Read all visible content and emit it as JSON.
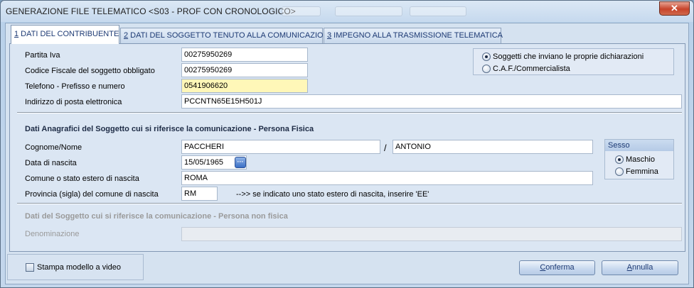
{
  "window": {
    "title": "GENERAZIONE FILE TELEMATICO <S03 - PROF CON CRONOLOGICO>",
    "close_glyph": "✕"
  },
  "tabs": [
    {
      "hotkey": "1",
      "label": " DATI DEL CONTRIBUENTE"
    },
    {
      "hotkey": "2",
      "label": " DATI DEL SOGGETTO TENUTO ALLA COMUNICAZIONE"
    },
    {
      "hotkey": "3",
      "label": " IMPEGNO ALLA TRASMISSIONE TELEMATICA"
    }
  ],
  "contribuente": {
    "partita_iva_label": "Partita Iva",
    "partita_iva_value": "00275950269",
    "codice_fiscale_label": "Codice Fiscale del soggetto obbligato",
    "codice_fiscale_value": "00275950269",
    "telefono_label": "Telefono - Prefisso e numero",
    "telefono_value": "0541906620",
    "email_label": "Indirizzo di posta elettronica",
    "email_value": "PCCNTN65E15H501J"
  },
  "tipo_soggetto": {
    "option1": "Soggetti che inviano le proprie dichiarazioni",
    "option2": "C.A.F./Commercialista",
    "selected": "option1"
  },
  "persona_fisica": {
    "heading": "Dati Anagrafici del Soggetto cui si riferisce la comunicazione - Persona Fisica",
    "cognome_nome_label": "Cognome/Nome",
    "cognome_value": "PACCHERI",
    "separator": "/",
    "nome_value": "ANTONIO",
    "data_nascita_label": "Data di nascita",
    "data_nascita_value": "15/05/1965",
    "comune_label": "Comune o stato estero di nascita",
    "comune_value": "ROMA",
    "provincia_label": "Provincia (sigla) del comune di nascita",
    "provincia_value": "RM",
    "provincia_hint": "-->> se indicato uno stato estero di nascita, inserire 'EE'"
  },
  "sesso": {
    "heading": "Sesso",
    "maschio": "Maschio",
    "femmina": "Femmina",
    "selected": "maschio"
  },
  "persona_non_fisica": {
    "heading": "Dati del Soggetto cui si riferisce la comunicazione - Persona non fisica",
    "denominazione_label": "Denominazione",
    "denominazione_value": ""
  },
  "footer": {
    "stampa_label": "Stampa modello a video",
    "conferma_hotkey": "C",
    "conferma_rest": "onferma",
    "annulla_hotkey": "A",
    "annulla_rest": "nnulla"
  }
}
